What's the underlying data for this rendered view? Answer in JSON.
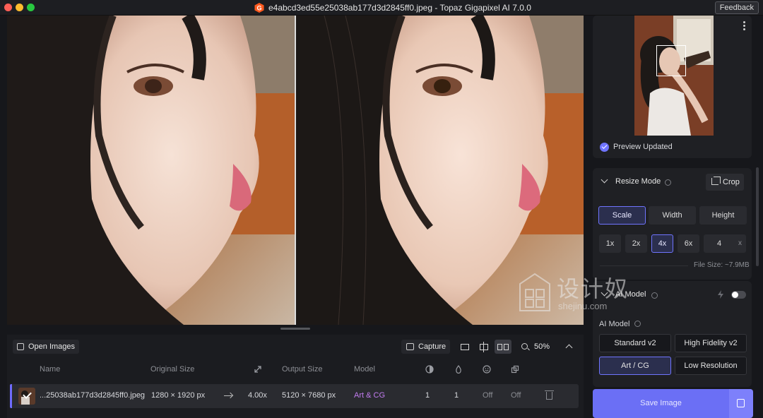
{
  "window": {
    "title": "e4abcd3ed55e25038ab177d3d2845ff0.jpeg - Topaz Gigapixel AI 7.0.0",
    "feedback": "Feedback"
  },
  "bottom_toolbar": {
    "open_images": "Open Images",
    "capture": "Capture",
    "zoom": "50%"
  },
  "table": {
    "headers": {
      "name": "Name",
      "original_size": "Original Size",
      "output_size": "Output Size",
      "model": "Model"
    },
    "rows": [
      {
        "name": "...25038ab177d3d2845ff0.jpeg",
        "original_size": "1280 × 1920 px",
        "scale": "4.00x",
        "output_size": "5120 × 7680 px",
        "model": "Art & CG",
        "col1": "1",
        "col2": "1",
        "col3": "Off",
        "col4": "Off"
      }
    ]
  },
  "preview": {
    "status": "Preview Updated"
  },
  "resize": {
    "title": "Resize Mode",
    "crop": "Crop",
    "modes": [
      "Scale",
      "Width",
      "Height"
    ],
    "active_mode": "Scale",
    "factors": [
      "1x",
      "2x",
      "4x",
      "6x"
    ],
    "active_factor": "4x",
    "custom_value": "4",
    "custom_suffix": "x",
    "file_size": "File Size: ~7.9MB"
  },
  "ai_model": {
    "title": "AI Model",
    "label": "AI Model",
    "models": [
      "Standard v2",
      "High Fidelity v2",
      "Art / CG",
      "Low Resolution"
    ],
    "active_model": "Art / CG"
  },
  "save": {
    "label": "Save Image"
  },
  "watermark": {
    "text": "设计奴",
    "url": "shejinu.com"
  },
  "colors": {
    "accent": "#6f74ff",
    "model_text": "#c27cf0",
    "background": "#16171b"
  }
}
